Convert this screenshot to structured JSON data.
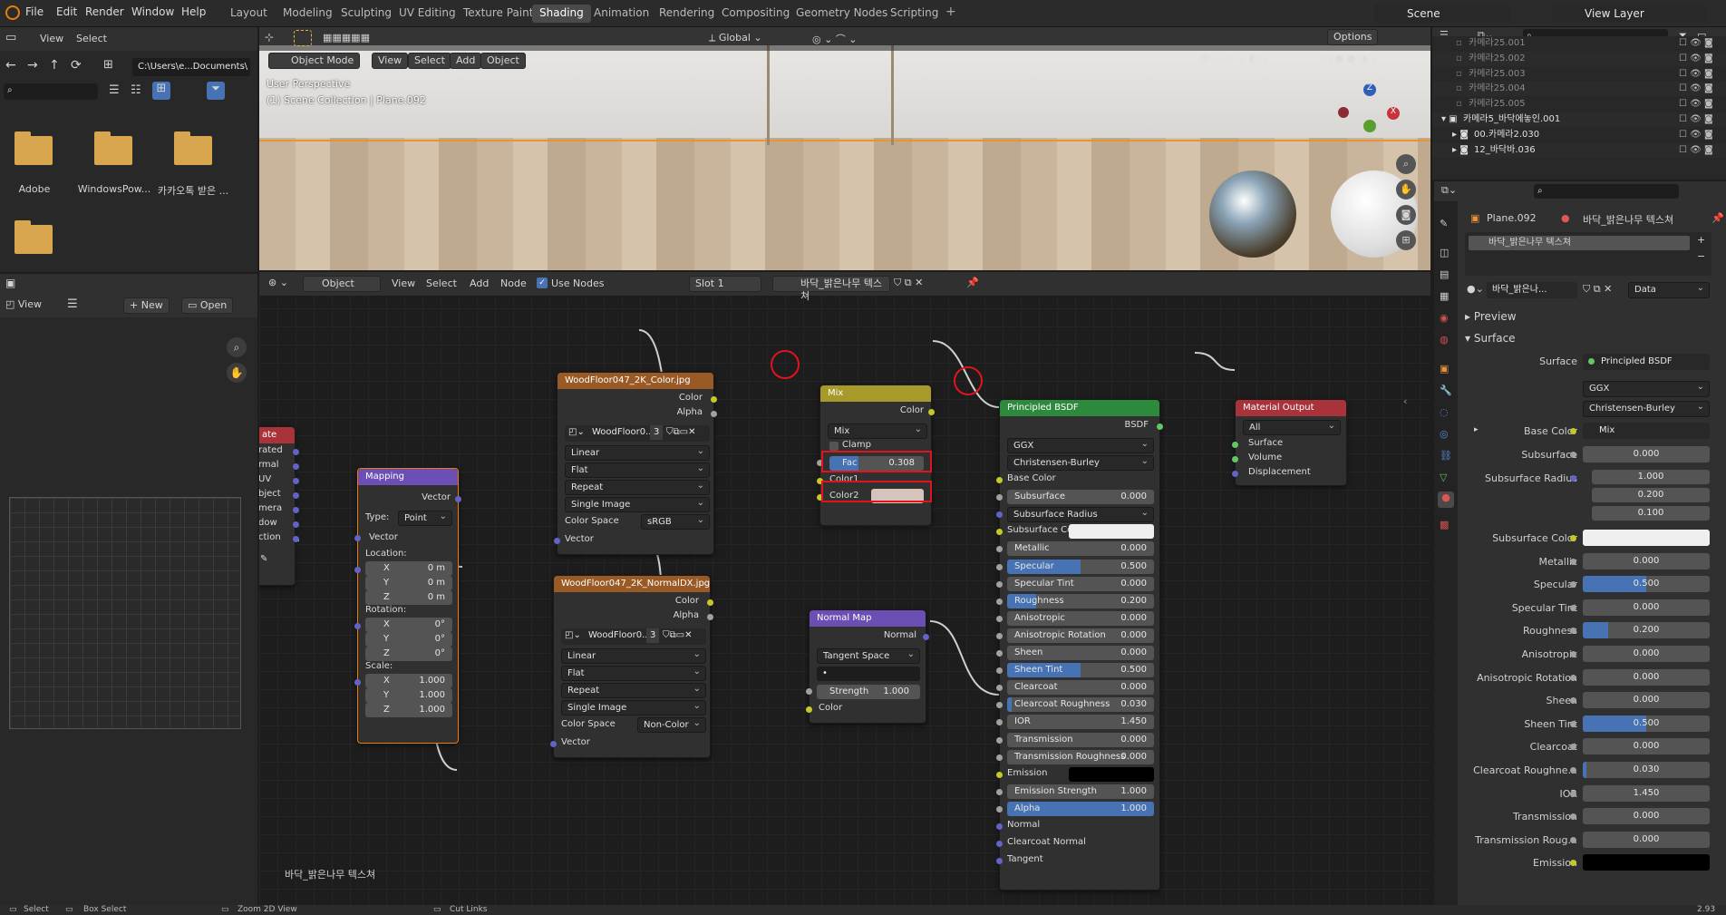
{
  "menu": [
    "File",
    "Edit",
    "Render",
    "Window",
    "Help"
  ],
  "workspaces": [
    "Layout",
    "Modeling",
    "Sculpting",
    "UV Editing",
    "Texture Paint",
    "Shading",
    "Animation",
    "Rendering",
    "Compositing",
    "Geometry Nodes",
    "Scripting"
  ],
  "active_workspace": "Shading",
  "scene": "Scene",
  "view_layer": "View Layer",
  "filebrowser": {
    "menus": [
      "View",
      "Select"
    ],
    "path": "C:\\Users\\e...Documents\\",
    "folders": [
      "Adobe",
      "WindowsPow...",
      "카카오톡 받은 ...",
      ""
    ]
  },
  "viewport": {
    "mode": "Object Mode",
    "menus": [
      "View",
      "Select",
      "Add",
      "Object"
    ],
    "orientation": "Global",
    "info_line1": "User Perspective",
    "info_line2": "(1) Scene Collection | Plane.092",
    "options": "Options"
  },
  "image_editor": {
    "view": "View",
    "new": "New",
    "open": "Open"
  },
  "node_editor": {
    "object": "Object",
    "menus": [
      "View",
      "Select",
      "Add",
      "Node"
    ],
    "use_nodes": "Use Nodes",
    "slot": "Slot 1",
    "material": "바닥_밝은나무 텍스쳐",
    "footer_label": "바닥_밝은나무 텍스쳐"
  },
  "tex_coord_node": {
    "title": "ate",
    "outputs": [
      "rated",
      "rmal",
      "UV",
      "bject",
      "mera",
      "dow",
      "ction"
    ]
  },
  "mapping_node": {
    "title": "Mapping",
    "output": "Vector",
    "type_label": "Type:",
    "type": "Point",
    "vector": "Vector",
    "location": "Location:",
    "rotation": "Rotation:",
    "scale": "Scale:",
    "loc": [
      {
        "a": "X",
        "v": "0 m"
      },
      {
        "a": "Y",
        "v": "0 m"
      },
      {
        "a": "Z",
        "v": "0 m"
      }
    ],
    "rot": [
      {
        "a": "X",
        "v": "0°"
      },
      {
        "a": "Y",
        "v": "0°"
      },
      {
        "a": "Z",
        "v": "0°"
      }
    ],
    "scl": [
      {
        "a": "X",
        "v": "1.000"
      },
      {
        "a": "Y",
        "v": "1.000"
      },
      {
        "a": "Z",
        "v": "1.000"
      }
    ]
  },
  "image_node_color": {
    "title": "WoodFloor047_2K_Color.jpg",
    "out_color": "Color",
    "out_alpha": "Alpha",
    "image": "WoodFloor0...",
    "users": "3",
    "interp": "Linear",
    "proj": "Flat",
    "ext": "Repeat",
    "source": "Single Image",
    "cs_label": "Color Space",
    "cs": "sRGB",
    "vector": "Vector"
  },
  "image_node_normal": {
    "title": "WoodFloor047_2K_NormalDX.jpg",
    "out_color": "Color",
    "out_alpha": "Alpha",
    "image": "WoodFloor0...",
    "users": "3",
    "interp": "Linear",
    "proj": "Flat",
    "ext": "Repeat",
    "source": "Single Image",
    "cs_label": "Color Space",
    "cs": "Non-Color",
    "vector": "Vector"
  },
  "mix_node": {
    "title": "Mix",
    "out": "Color",
    "blend": "Mix",
    "clamp": "Clamp",
    "fac_label": "Fac",
    "fac": "0.308",
    "fac_value": 0.308,
    "color1": "Color1",
    "color2": "Color2"
  },
  "normal_map_node": {
    "title": "Normal Map",
    "out": "Normal",
    "space": "Tangent Space",
    "uv": "•",
    "strength_label": "Strength",
    "strength": "1.000",
    "color": "Color"
  },
  "bsdf_node": {
    "title": "Principled BSDF",
    "out": "BSDF",
    "dist": "GGX",
    "sss": "Christensen-Burley",
    "rows": [
      {
        "l": "Base Color",
        "t": "sock"
      },
      {
        "l": "Subsurface",
        "v": "0.000",
        "f": 0
      },
      {
        "l": "Subsurface Radius",
        "t": "sel"
      },
      {
        "l": "Subsurface Co...",
        "t": "white"
      },
      {
        "l": "Metallic",
        "v": "0.000",
        "f": 0
      },
      {
        "l": "Specular",
        "v": "0.500",
        "f": 0.5
      },
      {
        "l": "Specular Tint",
        "v": "0.000",
        "f": 0
      },
      {
        "l": "Roughness",
        "v": "0.200",
        "f": 0.2
      },
      {
        "l": "Anisotropic",
        "v": "0.000",
        "f": 0
      },
      {
        "l": "Anisotropic Rotation",
        "v": "0.000",
        "f": 0
      },
      {
        "l": "Sheen",
        "v": "0.000",
        "f": 0
      },
      {
        "l": "Sheen Tint",
        "v": "0.500",
        "f": 0.5
      },
      {
        "l": "Clearcoat",
        "v": "0.000",
        "f": 0
      },
      {
        "l": "Clearcoat Roughness",
        "v": "0.030",
        "f": 0.03
      },
      {
        "l": "IOR",
        "v": "1.450",
        "f": 0
      },
      {
        "l": "Transmission",
        "v": "0.000",
        "f": 0
      },
      {
        "l": "Transmission Roughness",
        "v": "0.000",
        "f": 0
      },
      {
        "l": "Emission",
        "t": "black"
      },
      {
        "l": "Emission Strength",
        "v": "1.000",
        "f": 0
      },
      {
        "l": "Alpha",
        "v": "1.000",
        "f": 1
      },
      {
        "l": "Normal",
        "t": "sock"
      },
      {
        "l": "Clearcoat Normal",
        "t": "sock"
      },
      {
        "l": "Tangent",
        "t": "sock"
      }
    ]
  },
  "output_node": {
    "title": "Material Output",
    "target": "All",
    "inputs": [
      "Surface",
      "Volume",
      "Displacement"
    ]
  },
  "outliner": {
    "items": [
      "카메라25.001",
      "카메라25.002",
      "카메라25.003",
      "카메라25.004",
      "카메라25.005",
      "카메라5_바닥에놓인.001",
      "00.카메라2.030",
      "12_바닥바.036"
    ]
  },
  "properties": {
    "object": "Plane.092",
    "material": "바닥_밝은나무 텍스쳐",
    "slot": "바닥_밝은나무 텍스쳐",
    "mat_field": "바닥_밝은나...",
    "data": "Data",
    "preview": "Preview",
    "surface_panel": "Surface",
    "surface_label": "Surface",
    "surface": "Principled BSDF",
    "dist": "GGX",
    "sss": "Christensen-Burley",
    "rows": [
      {
        "l": "Base Color",
        "t": "mix",
        "v": "Mix"
      },
      {
        "l": "Subsurface",
        "v": "0.000",
        "f": 0
      },
      {
        "l": "Subsurface Radius",
        "t": "vec",
        "vals": [
          "1.000",
          "0.200",
          "0.100"
        ]
      },
      {
        "l": "Subsurface Color",
        "t": "white"
      },
      {
        "l": "Metallic",
        "v": "0.000",
        "f": 0
      },
      {
        "l": "Specular",
        "v": "0.500",
        "f": 0.5
      },
      {
        "l": "Specular Tint",
        "v": "0.000",
        "f": 0
      },
      {
        "l": "Roughness",
        "v": "0.200",
        "f": 0.2
      },
      {
        "l": "Anisotropic",
        "v": "0.000",
        "f": 0
      },
      {
        "l": "Anisotropic Rotation",
        "v": "0.000",
        "f": 0
      },
      {
        "l": "Sheen",
        "v": "0.000",
        "f": 0
      },
      {
        "l": "Sheen Tint",
        "v": "0.500",
        "f": 0.5
      },
      {
        "l": "Clearcoat",
        "v": "0.000",
        "f": 0
      },
      {
        "l": "Clearcoat Roughne...",
        "v": "0.030",
        "f": 0.03
      },
      {
        "l": "IOR",
        "v": "1.450",
        "f": 0
      },
      {
        "l": "Transmission",
        "v": "0.000",
        "f": 0
      },
      {
        "l": "Transmission Roug...",
        "v": "0.000",
        "f": 0
      },
      {
        "l": "Emission",
        "t": "black"
      }
    ]
  },
  "statusbar": {
    "select": "Select",
    "box": "Box Select",
    "zoom": "Zoom 2D View",
    "cut": "Cut Links",
    "version": "2.93"
  },
  "colors": {
    "accent": "#4772b3",
    "highlight": "#e0141e",
    "image_header": "#9a5a25",
    "mix_header": "#a89a2a",
    "bsdf_header": "#2d8a3d",
    "output_header": "#a8333a",
    "vector_header": "#6b4fb5"
  }
}
